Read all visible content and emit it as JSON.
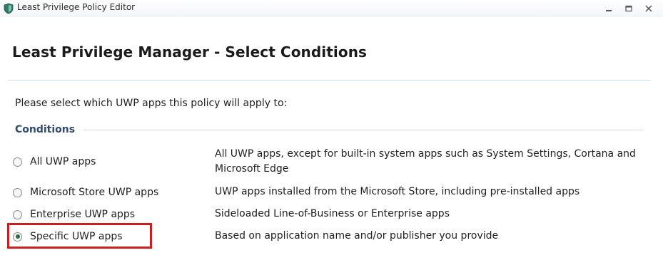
{
  "window": {
    "title": "Least Privilege Policy Editor",
    "icon": "shield-icon",
    "controls": [
      "minimize-icon",
      "maximize-icon",
      "close-icon"
    ]
  },
  "page": {
    "title": "Least Privilege Manager - Select Conditions",
    "prompt": "Please select which UWP apps this policy will apply to:",
    "group_label": "Conditions"
  },
  "options": [
    {
      "label": "All UWP apps",
      "description": "All UWP apps, except for built-in system apps such as System Settings, Cortana and Microsoft Edge",
      "selected": false
    },
    {
      "label": "Microsoft Store UWP apps",
      "description": "UWP apps installed from the Microsoft Store, including pre-installed apps",
      "selected": false
    },
    {
      "label": "Enterprise UWP apps",
      "description": "Sideloaded Line-of-Business or Enterprise apps",
      "selected": false
    },
    {
      "label": "Specific UWP apps",
      "description": "Based on application name and/or publisher you provide",
      "selected": true
    }
  ],
  "colors": {
    "accent_rule": "#c9dbea",
    "group_label": "#2f4b6e",
    "highlight": "#cc1f1f"
  }
}
